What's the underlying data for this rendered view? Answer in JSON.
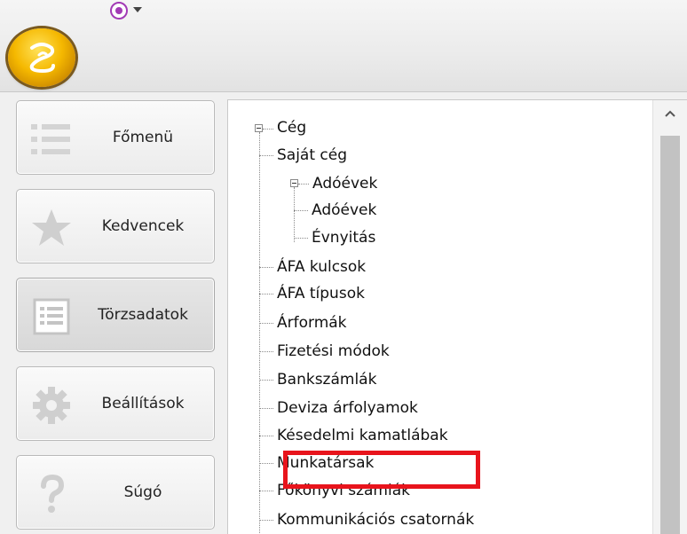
{
  "nav": {
    "items": [
      {
        "label": "Főmenü",
        "icon": "list-icon"
      },
      {
        "label": "Kedvencek",
        "icon": "star-icon"
      },
      {
        "label": "Törzsadatok",
        "icon": "document-icon"
      },
      {
        "label": "Beállítások",
        "icon": "gear-icon"
      },
      {
        "label": "Súgó",
        "icon": "question-icon"
      }
    ],
    "active": "Törzsadatok"
  },
  "tree": {
    "root": "Cég",
    "nodes": [
      "Saját cég",
      "Adóévek",
      "Adóévek",
      "Évnyitás",
      "ÁFA kulcsok",
      "ÁFA típusok",
      "Árformák",
      "Fizetési módok",
      "Bankszámlák",
      "Deviza árfolyamok",
      "Késedelmi kamatlábak",
      "Munkatársak",
      "Főkönyvi számlák",
      "Kommunikációs csatornák"
    ],
    "highlighted": "Főkönyvi számlák"
  },
  "colors": {
    "highlight": "#e8141c",
    "orb": "#f5b800",
    "qat": "#a23ab5"
  }
}
